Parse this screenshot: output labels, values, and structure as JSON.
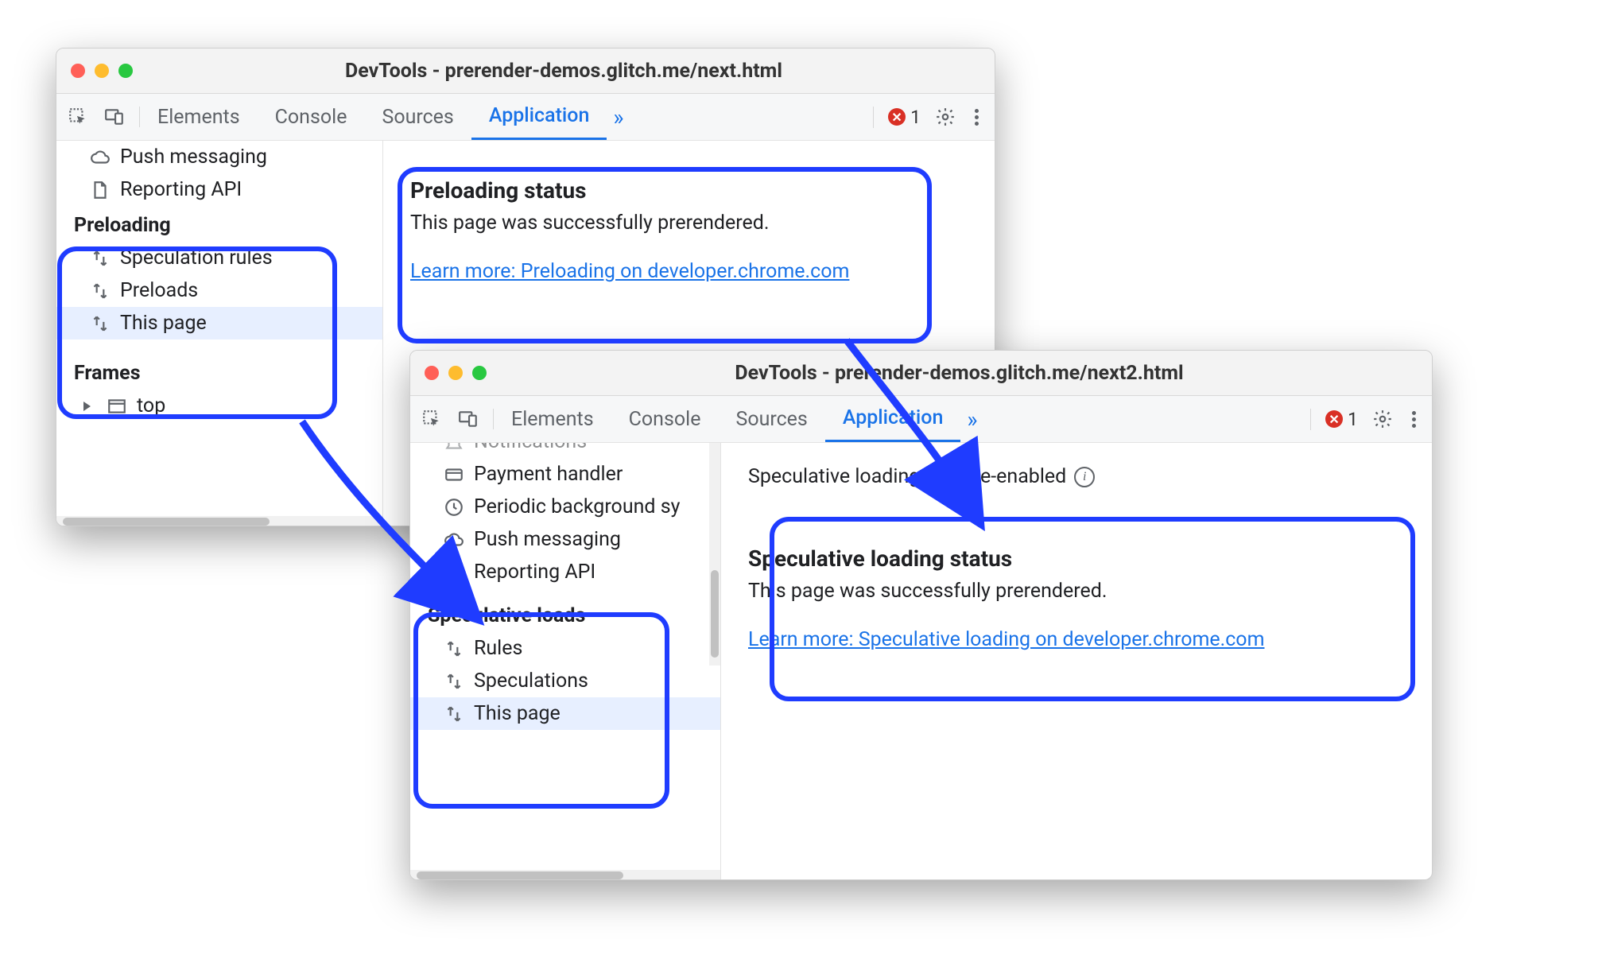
{
  "colors": {
    "accent": "#1a73e8",
    "highlight": "#1f3cff",
    "error": "#d93025"
  },
  "window1": {
    "title": "DevTools - prerender-demos.glitch.me/next.html",
    "tabs": {
      "elements": "Elements",
      "console": "Console",
      "sources": "Sources",
      "application": "Application"
    },
    "errorCount": "1",
    "sidebar": {
      "items_above": [
        {
          "label": "Push messaging",
          "icon": "cloud-icon"
        },
        {
          "label": "Reporting API",
          "icon": "file-icon"
        }
      ],
      "preloading_header": "Preloading",
      "preloading_items": [
        {
          "label": "Speculation rules"
        },
        {
          "label": "Preloads"
        },
        {
          "label": "This page",
          "selected": true
        }
      ],
      "frames_header": "Frames",
      "frames_top": "top"
    },
    "panel": {
      "heading": "Preloading status",
      "text": "This page was successfully prerendered.",
      "link": "Learn more: Preloading on developer.chrome.com"
    }
  },
  "window2": {
    "title": "DevTools - prerender-demos.glitch.me/next2.html",
    "tabs": {
      "elements": "Elements",
      "console": "Console",
      "sources": "Sources",
      "application": "Application"
    },
    "errorCount": "1",
    "sidebar": {
      "items_above": [
        {
          "label": "Notifications",
          "icon": "bell-icon",
          "cut": true
        },
        {
          "label": "Payment handler",
          "icon": "card-icon"
        },
        {
          "label": "Periodic background sy",
          "icon": "clock-icon"
        },
        {
          "label": "Push messaging",
          "icon": "cloud-icon"
        },
        {
          "label": "Reporting API",
          "icon": "file-icon"
        }
      ],
      "spec_header": "Speculative loads",
      "spec_items": [
        {
          "label": "Rules"
        },
        {
          "label": "Speculations"
        },
        {
          "label": "This page",
          "selected": true
        }
      ]
    },
    "info_line": "Speculative loading is force-enabled",
    "panel": {
      "heading": "Speculative loading status",
      "text": "This page was successfully prerendered.",
      "link": "Learn more: Speculative loading on developer.chrome.com"
    }
  }
}
